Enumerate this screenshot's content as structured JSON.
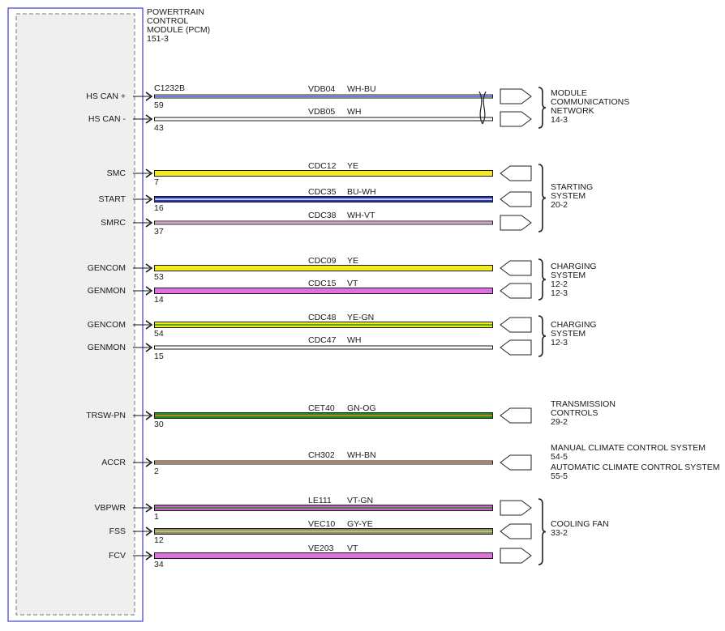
{
  "module": {
    "lines": [
      "POWERTRAIN",
      "CONTROL",
      "MODULE (PCM)",
      "151-3"
    ],
    "connector": "C1232B",
    "border_color": "#3b3bd6"
  },
  "wires": [
    {
      "signal": "HS CAN +",
      "pin": "59",
      "circuit": "VDB04",
      "color_code": "WH-BU",
      "colors": [
        "#ffffff",
        "#3a4fd0"
      ],
      "thin": true,
      "connector_dir": "right",
      "twisted": true
    },
    {
      "signal": "HS CAN -",
      "pin": "43",
      "circuit": "VDB05",
      "color_code": "WH",
      "colors": [
        "#ffffff"
      ],
      "thin": true,
      "connector_dir": "right",
      "twisted": true
    },
    {
      "signal": "SMC",
      "pin": "7",
      "circuit": "CDC12",
      "color_code": "YE",
      "colors": [
        "#f2ec1c"
      ],
      "thin": false,
      "connector_dir": "left"
    },
    {
      "signal": "START",
      "pin": "16",
      "circuit": "CDC35",
      "color_code": "BU-WH",
      "colors": [
        "#2233cc",
        "#ffffff"
      ],
      "thin": false,
      "connector_dir": "left"
    },
    {
      "signal": "SMRC",
      "pin": "37",
      "circuit": "CDC38",
      "color_code": "WH-VT",
      "colors": [
        "#ffffff",
        "#c678c6"
      ],
      "thin": true,
      "connector_dir": "right"
    },
    {
      "signal": "GENCOM",
      "pin": "53",
      "circuit": "CDC09",
      "color_code": "YE",
      "colors": [
        "#f2ec1c"
      ],
      "thin": false,
      "connector_dir": "left"
    },
    {
      "signal": "GENMON",
      "pin": "14",
      "circuit": "CDC15",
      "color_code": "VT",
      "colors": [
        "#e070e0"
      ],
      "thin": false,
      "connector_dir": "left"
    },
    {
      "signal": "GENCOM",
      "pin": "54",
      "circuit": "CDC48",
      "color_code": "YE-GN",
      "colors": [
        "#f2ec1c",
        "#2a8a2a"
      ],
      "thin": false,
      "connector_dir": "left"
    },
    {
      "signal": "GENMON",
      "pin": "15",
      "circuit": "CDC47",
      "color_code": "WH",
      "colors": [
        "#ffffff"
      ],
      "thin": true,
      "connector_dir": "left"
    },
    {
      "signal": "TRSW-PN",
      "pin": "30",
      "circuit": "CET40",
      "color_code": "GN-OG",
      "colors": [
        "#1f8a1f",
        "#e08a20"
      ],
      "thin": false,
      "connector_dir": "left"
    },
    {
      "signal": "ACCR",
      "pin": "2",
      "circuit": "CH302",
      "color_code": "WH-BN",
      "colors": [
        "#ffffff",
        "#a0522d"
      ],
      "thin": true,
      "connector_dir": "left"
    },
    {
      "signal": "VBPWR",
      "pin": "1",
      "circuit": "LE111",
      "color_code": "VT-GN",
      "colors": [
        "#c860c8",
        "#2a8a2a"
      ],
      "thin": false,
      "connector_dir": "right"
    },
    {
      "signal": "FSS",
      "pin": "12",
      "circuit": "VEC10",
      "color_code": "GY-YE",
      "colors": [
        "#8a8a8a",
        "#e0da20"
      ],
      "thin": false,
      "connector_dir": "left"
    },
    {
      "signal": "FCV",
      "pin": "34",
      "circuit": "VE203",
      "color_code": "VT",
      "colors": [
        "#e070e0"
      ],
      "thin": false,
      "connector_dir": "right"
    }
  ],
  "destinations": [
    {
      "lines": [
        "MODULE",
        "COMMUNICATIONS",
        "NETWORK",
        "14-3"
      ],
      "wires": [
        0,
        1
      ]
    },
    {
      "lines": [
        "STARTING",
        "SYSTEM",
        "20-2"
      ],
      "wires": [
        2,
        3,
        4
      ]
    },
    {
      "lines": [
        "CHARGING",
        "SYSTEM",
        "12-2",
        "12-3"
      ],
      "wires": [
        5,
        6
      ]
    },
    {
      "lines": [
        "CHARGING",
        "SYSTEM",
        "12-3"
      ],
      "wires": [
        7,
        8
      ]
    },
    {
      "lines": [
        "TRANSMISSION",
        "CONTROLS",
        "29-2"
      ],
      "wires": [
        9
      ]
    },
    {
      "lines": [
        "MANUAL CLIMATE CONTROL SYSTEM",
        "54-5"
      ],
      "wires": [
        10
      ]
    },
    {
      "lines": [
        "AUTOMATIC CLIMATE CONTROL SYSTEM",
        "55-5"
      ],
      "wires": []
    },
    {
      "lines": [
        "COOLING FAN",
        "33-2"
      ],
      "wires": [
        11,
        12,
        13
      ]
    }
  ]
}
